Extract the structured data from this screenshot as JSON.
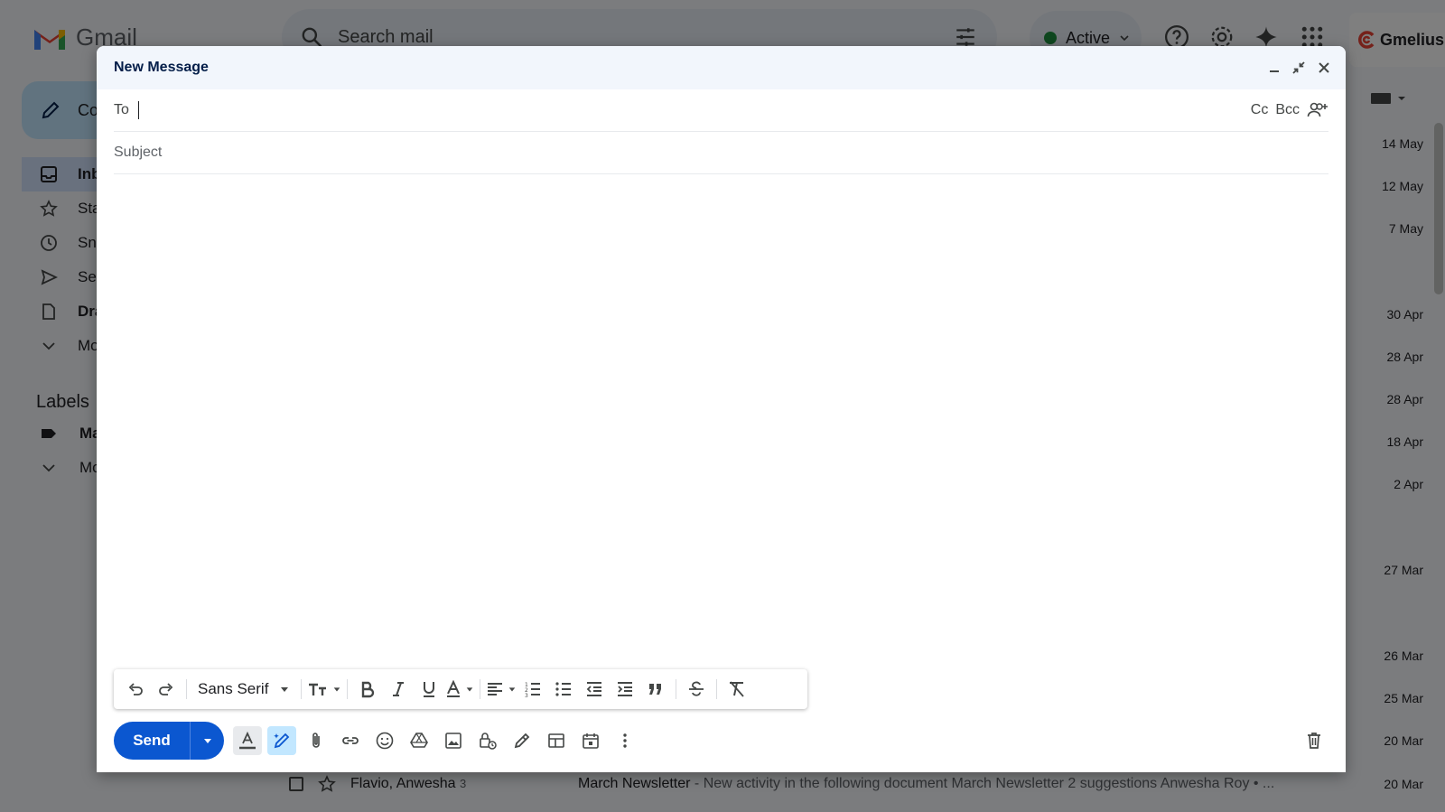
{
  "app": {
    "logo_text": "Gmail",
    "search_placeholder": "Search mail",
    "status_label": "Active",
    "gmelius_label": "Gmelius"
  },
  "sidebar": {
    "compose_label": "Co",
    "items": [
      {
        "label": "Inb",
        "icon": "inbox-icon"
      },
      {
        "label": "Sta",
        "icon": "star-icon"
      },
      {
        "label": "Sn",
        "icon": "clock-icon"
      },
      {
        "label": "Se",
        "icon": "send-icon"
      },
      {
        "label": "Dra",
        "icon": "draft-icon"
      },
      {
        "label": "Mo",
        "icon": "chevron-down-icon"
      }
    ],
    "labels_heading": "Labels",
    "label_items": [
      {
        "label": "Ma",
        "icon": "label-icon"
      },
      {
        "label": "Mo",
        "icon": "chevron-down-icon"
      }
    ]
  },
  "mail_dates": [
    "14 May",
    "12 May",
    "7 May",
    "30 Apr",
    "28 Apr",
    "28 Apr",
    "18 Apr",
    "2 Apr",
    "27 Mar",
    "26 Mar",
    "25 Mar",
    "20 Mar",
    "20 Mar"
  ],
  "last_row": {
    "from": "Flavio, Anwesha",
    "count": "3",
    "subject": "March Newsletter",
    "snippet": " - New activity in the following document March Newsletter 2 suggestions Anwesha Roy • ..."
  },
  "compose": {
    "title": "New Message",
    "to_label": "To",
    "to_value": "",
    "cc_label": "Cc",
    "bcc_label": "Bcc",
    "subject_placeholder": "Subject",
    "font_name": "Sans Serif",
    "send_label": "Send"
  },
  "colors": {
    "send_blue": "#0b57d0",
    "header_bg": "#f2f6fc",
    "active_green": "#1e8e3e",
    "gmail_red": "#ea4335"
  }
}
